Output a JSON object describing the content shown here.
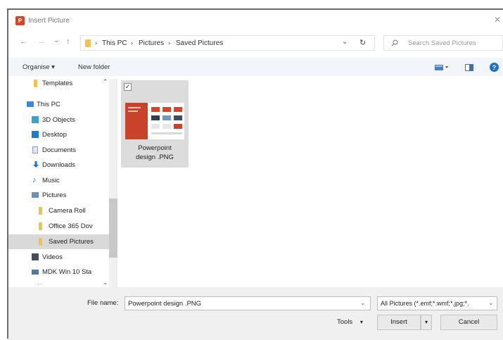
{
  "window": {
    "title": "Insert Picture",
    "close_glyph": "✕"
  },
  "nav": {
    "back": "←",
    "forward": "→",
    "recent": "⌄",
    "up": "↑"
  },
  "address": {
    "segments": [
      "This PC",
      "Pictures",
      "Saved Pictures"
    ],
    "separator": "›",
    "dropdown": "⌄",
    "refresh": "↻"
  },
  "search": {
    "placeholder": "Search Saved Pictures"
  },
  "toolbar": {
    "organise": "Organise ▾",
    "new_folder": "New folder"
  },
  "sidebar": {
    "items": [
      {
        "label": "Templates",
        "icon": "folder-icon",
        "level": 1
      },
      {
        "label": "This PC",
        "icon": "computer-icon",
        "level": 0
      },
      {
        "label": "3D Objects",
        "icon": "cube-icon",
        "level": 1
      },
      {
        "label": "Desktop",
        "icon": "desktop-icon",
        "level": 1
      },
      {
        "label": "Documents",
        "icon": "document-icon",
        "level": 1
      },
      {
        "label": "Downloads",
        "icon": "download-icon",
        "level": 1
      },
      {
        "label": "Music",
        "icon": "music-icon",
        "level": 1
      },
      {
        "label": "Pictures",
        "icon": "pictures-icon",
        "level": 1
      },
      {
        "label": "Camera Roll",
        "icon": "folder-icon",
        "level": 2
      },
      {
        "label": "Office 365 Dov",
        "icon": "folder-icon",
        "level": 2
      },
      {
        "label": "Saved Pictures",
        "icon": "folder-icon",
        "level": 2,
        "selected": true
      },
      {
        "label": "Videos",
        "icon": "video-icon",
        "level": 1
      },
      {
        "label": "MDK Win 10 Sta",
        "icon": "network-drive-icon",
        "level": 1
      }
    ],
    "overflow": "..."
  },
  "files": [
    {
      "name": "Powerpoint design .PNG",
      "line1": "Powerpoint",
      "line2": "design .PNG",
      "checked": true
    }
  ],
  "bottom": {
    "file_name_label": "File name:",
    "file_name_value": "Powerpoint design .PNG",
    "file_type": "All Pictures (*.emf;*.wmf;*.jpg;*.",
    "tools": "Tools",
    "insert": "Insert",
    "cancel": "Cancel",
    "caret": "▾"
  },
  "colors": {
    "accent": "#2b7cd3",
    "ppt": "#d24726",
    "folder": "#f2c14e",
    "selected": "#d9d9d9"
  }
}
